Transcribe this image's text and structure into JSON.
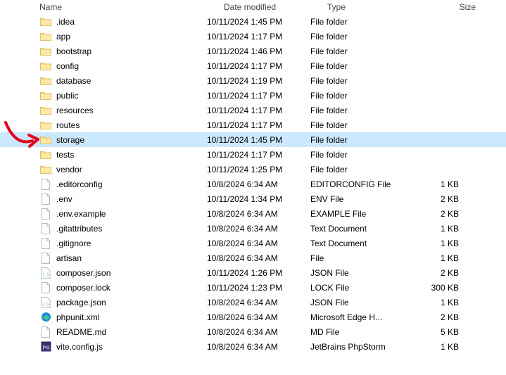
{
  "columns": {
    "name": "Name",
    "date": "Date modified",
    "type": "Type",
    "size": "Size"
  },
  "items": [
    {
      "icon": "folder",
      "name": ".idea",
      "date": "10/11/2024 1:45 PM",
      "type": "File folder",
      "size": "",
      "selected": false
    },
    {
      "icon": "folder",
      "name": "app",
      "date": "10/11/2024 1:17 PM",
      "type": "File folder",
      "size": "",
      "selected": false
    },
    {
      "icon": "folder",
      "name": "bootstrap",
      "date": "10/11/2024 1:46 PM",
      "type": "File folder",
      "size": "",
      "selected": false
    },
    {
      "icon": "folder",
      "name": "config",
      "date": "10/11/2024 1:17 PM",
      "type": "File folder",
      "size": "",
      "selected": false
    },
    {
      "icon": "folder",
      "name": "database",
      "date": "10/11/2024 1:19 PM",
      "type": "File folder",
      "size": "",
      "selected": false
    },
    {
      "icon": "folder",
      "name": "public",
      "date": "10/11/2024 1:17 PM",
      "type": "File folder",
      "size": "",
      "selected": false
    },
    {
      "icon": "folder",
      "name": "resources",
      "date": "10/11/2024 1:17 PM",
      "type": "File folder",
      "size": "",
      "selected": false
    },
    {
      "icon": "folder",
      "name": "routes",
      "date": "10/11/2024 1:17 PM",
      "type": "File folder",
      "size": "",
      "selected": false
    },
    {
      "icon": "folder",
      "name": "storage",
      "date": "10/11/2024 1:45 PM",
      "type": "File folder",
      "size": "",
      "selected": true
    },
    {
      "icon": "folder",
      "name": "tests",
      "date": "10/11/2024 1:17 PM",
      "type": "File folder",
      "size": "",
      "selected": false
    },
    {
      "icon": "folder",
      "name": "vendor",
      "date": "10/11/2024 1:25 PM",
      "type": "File folder",
      "size": "",
      "selected": false
    },
    {
      "icon": "file",
      "name": ".editorconfig",
      "date": "10/8/2024 6:34 AM",
      "type": "EDITORCONFIG File",
      "size": "1 KB",
      "selected": false
    },
    {
      "icon": "file",
      "name": ".env",
      "date": "10/11/2024 1:34 PM",
      "type": "ENV File",
      "size": "2 KB",
      "selected": false
    },
    {
      "icon": "file",
      "name": ".env.example",
      "date": "10/8/2024 6:34 AM",
      "type": "EXAMPLE File",
      "size": "2 KB",
      "selected": false
    },
    {
      "icon": "file",
      "name": ".gitattributes",
      "date": "10/8/2024 6:34 AM",
      "type": "Text Document",
      "size": "1 KB",
      "selected": false
    },
    {
      "icon": "file",
      "name": ".gitignore",
      "date": "10/8/2024 6:34 AM",
      "type": "Text Document",
      "size": "1 KB",
      "selected": false
    },
    {
      "icon": "file",
      "name": "artisan",
      "date": "10/8/2024 6:34 AM",
      "type": "File",
      "size": "1 KB",
      "selected": false
    },
    {
      "icon": "json",
      "name": "composer.json",
      "date": "10/11/2024 1:26 PM",
      "type": "JSON File",
      "size": "2 KB",
      "selected": false
    },
    {
      "icon": "file",
      "name": "composer.lock",
      "date": "10/11/2024 1:23 PM",
      "type": "LOCK File",
      "size": "300 KB",
      "selected": false
    },
    {
      "icon": "json",
      "name": "package.json",
      "date": "10/8/2024 6:34 AM",
      "type": "JSON File",
      "size": "1 KB",
      "selected": false
    },
    {
      "icon": "edge",
      "name": "phpunit.xml",
      "date": "10/8/2024 6:34 AM",
      "type": "Microsoft Edge H...",
      "size": "2 KB",
      "selected": false
    },
    {
      "icon": "file",
      "name": "README.md",
      "date": "10/8/2024 6:34 AM",
      "type": "MD File",
      "size": "5 KB",
      "selected": false
    },
    {
      "icon": "ps",
      "name": "vite.config.js",
      "date": "10/8/2024 6:34 AM",
      "type": "JetBrains PhpStorm",
      "size": "1 KB",
      "selected": false
    }
  ]
}
